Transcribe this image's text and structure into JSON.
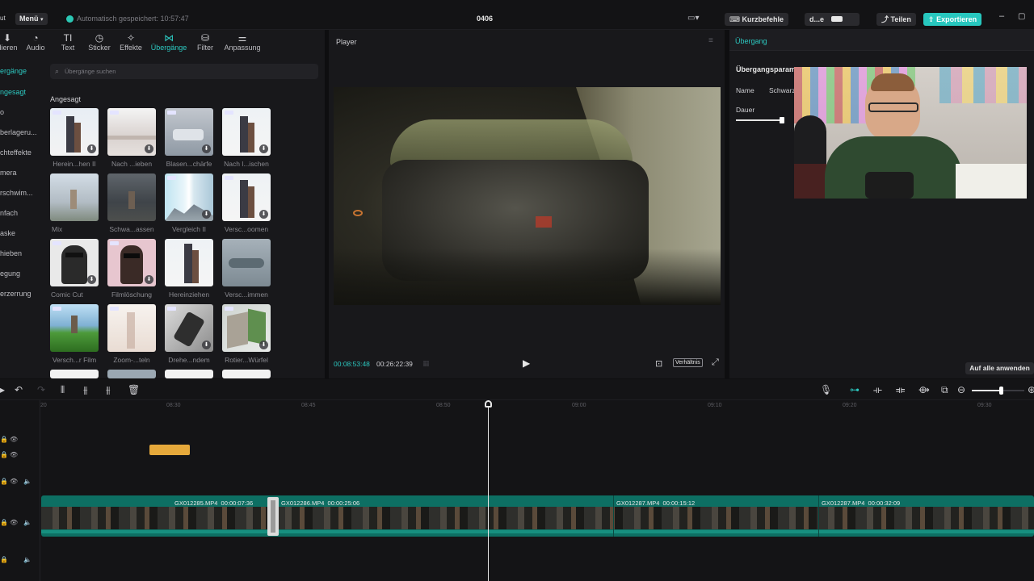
{
  "topbar": {
    "app_label": "ut",
    "menu_label": "Menü",
    "autosave_text": "Automatisch gespeichert: 10:57:47",
    "project_name": "0406",
    "shortcuts_label": "Kurzbefehle",
    "user_label": "d...e",
    "share_label": "Teilen",
    "export_label": "Exportieren",
    "accent_color": "#27c7be"
  },
  "tools": [
    {
      "label": "dieren",
      "icon": "import-icon"
    },
    {
      "label": "Audio",
      "icon": "audio-icon"
    },
    {
      "label": "Text",
      "icon": "text-icon"
    },
    {
      "label": "Sticker",
      "icon": "sticker-icon"
    },
    {
      "label": "Effekte",
      "icon": "effects-icon"
    },
    {
      "label": "Übergänge",
      "icon": "transitions-icon",
      "active": true
    },
    {
      "label": "Filter",
      "icon": "filter-icon"
    },
    {
      "label": "Anpassung",
      "icon": "adjust-icon"
    }
  ],
  "sidebar": {
    "items": [
      {
        "label": "ergänge",
        "active": true
      },
      {
        "label": "ngesagt",
        "active": true
      },
      {
        "label": "o"
      },
      {
        "label": "berlageru..."
      },
      {
        "label": "chteffekte"
      },
      {
        "label": "mera"
      },
      {
        "label": "rschwim..."
      },
      {
        "label": "nfach"
      },
      {
        "label": "aske"
      },
      {
        "label": "hieben"
      },
      {
        "label": "egung"
      },
      {
        "label": "erzerrung"
      }
    ]
  },
  "library": {
    "search_placeholder": "Übergänge suchen",
    "section_title": "Angesagt",
    "items": [
      {
        "label": "Herein...hen II"
      },
      {
        "label": "Nach ...ieben"
      },
      {
        "label": "Blasen...chärfe"
      },
      {
        "label": "Nach l...ischen"
      },
      {
        "label": "Mix"
      },
      {
        "label": "Schwa...assen"
      },
      {
        "label": "Vergleich II"
      },
      {
        "label": "Versc...oomen"
      },
      {
        "label": "Comic Cut"
      },
      {
        "label": "Filmlöschung"
      },
      {
        "label": "Hereinziehen"
      },
      {
        "label": "Versc...immen"
      },
      {
        "label": "Versch...r Film"
      },
      {
        "label": "Zoom-...teln"
      },
      {
        "label": "Drehe...ndem"
      },
      {
        "label": "Rotier...Würfel"
      }
    ]
  },
  "player": {
    "title": "Player",
    "current_time": "00:08:53:48",
    "total_time": "00:26:22:39",
    "ratio_label": "Verhältnis"
  },
  "inspector": {
    "tab_label": "Übergang",
    "section_title": "Übergangsparam",
    "name_label": "Name",
    "name_value": "Schwarz",
    "duration_label": "Dauer",
    "duration_fraction": 0.98,
    "apply_all_label": "Auf alle anwenden"
  },
  "timeline": {
    "ruler": [
      "20",
      "08:30",
      "08:45",
      "08:50",
      "09:00",
      "09:10",
      "09:20",
      "09:30"
    ],
    "clips": [
      {
        "name": "GX012285.MP4",
        "duration": "00:00:07:36"
      },
      {
        "name": "GX012286.MP4",
        "duration": "00:00:25:06"
      },
      {
        "name": "GX012287.MP4",
        "duration": "00:00:15:12"
      },
      {
        "name": "GX012287.MP4",
        "duration": "00:00:32:09"
      }
    ],
    "zoom_fraction": 0.55
  }
}
